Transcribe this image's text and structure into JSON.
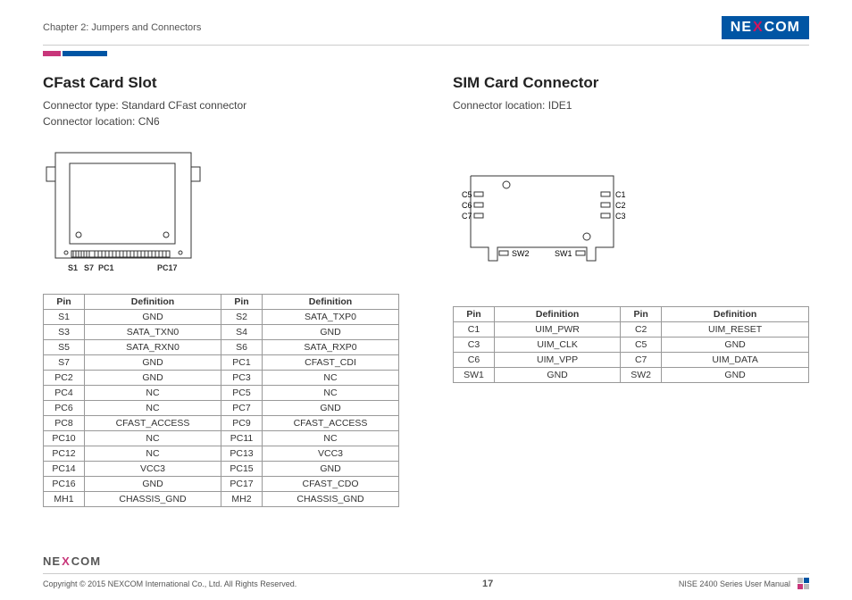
{
  "header": {
    "chapter": "Chapter 2: Jumpers and Connectors",
    "logo_pre": "NE",
    "logo_mid": "X",
    "logo_post": "COM"
  },
  "left": {
    "title": "CFast Card Slot",
    "type_label": "Connector type: Standard CFast connector",
    "loc_label": "Connector location: CN6",
    "diagram_labels": {
      "s1": "S1",
      "s7": "S7",
      "pc1": "PC1",
      "pc17": "PC17"
    },
    "table": {
      "headers": {
        "pin": "Pin",
        "def": "Definition"
      },
      "rows": [
        [
          "S1",
          "GND",
          "S2",
          "SATA_TXP0"
        ],
        [
          "S3",
          "SATA_TXN0",
          "S4",
          "GND"
        ],
        [
          "S5",
          "SATA_RXN0",
          "S6",
          "SATA_RXP0"
        ],
        [
          "S7",
          "GND",
          "PC1",
          "CFAST_CDI"
        ],
        [
          "PC2",
          "GND",
          "PC3",
          "NC"
        ],
        [
          "PC4",
          "NC",
          "PC5",
          "NC"
        ],
        [
          "PC6",
          "NC",
          "PC7",
          "GND"
        ],
        [
          "PC8",
          "CFAST_ACCESS",
          "PC9",
          "CFAST_ACCESS"
        ],
        [
          "PC10",
          "NC",
          "PC11",
          "NC"
        ],
        [
          "PC12",
          "NC",
          "PC13",
          "VCC3"
        ],
        [
          "PC14",
          "VCC3",
          "PC15",
          "GND"
        ],
        [
          "PC16",
          "GND",
          "PC17",
          "CFAST_CDO"
        ],
        [
          "MH1",
          "CHASSIS_GND",
          "MH2",
          "CHASSIS_GND"
        ]
      ]
    }
  },
  "right": {
    "title": "SIM Card Connector",
    "loc_label": "Connector location: IDE1",
    "diagram_labels": {
      "c1": "C1",
      "c2": "C2",
      "c3": "C3",
      "c5": "C5",
      "c6": "C6",
      "c7": "C7",
      "sw1": "SW1",
      "sw2": "SW2"
    },
    "table": {
      "headers": {
        "pin": "Pin",
        "def": "Definition"
      },
      "rows": [
        [
          "C1",
          "UIM_PWR",
          "C2",
          "UIM_RESET"
        ],
        [
          "C3",
          "UIM_CLK",
          "C5",
          "GND"
        ],
        [
          "C6",
          "UIM_VPP",
          "C7",
          "UIM_DATA"
        ],
        [
          "SW1",
          "GND",
          "SW2",
          "GND"
        ]
      ]
    }
  },
  "footer": {
    "logo_pre": "NE",
    "logo_mid": "X",
    "logo_post": "COM",
    "copyright": "Copyright © 2015 NEXCOM International Co., Ltd. All Rights Reserved.",
    "page": "17",
    "manual": "NISE 2400 Series User Manual"
  }
}
